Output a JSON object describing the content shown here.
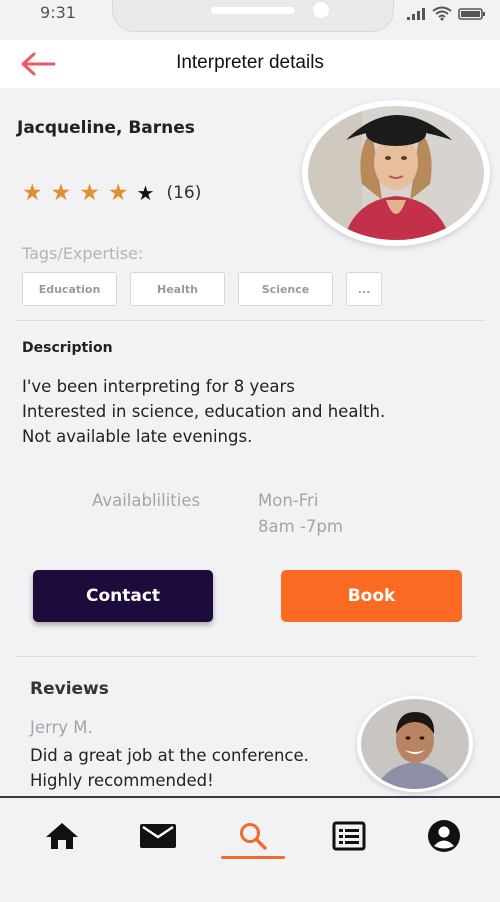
{
  "status_bar": {
    "time": "9:31"
  },
  "header": {
    "title": "Interpreter details",
    "back_icon": "arrow-left-icon",
    "accent": "#f05a5a"
  },
  "profile": {
    "name": "Jacqueline, Barnes",
    "rating": {
      "stars_filled": 4,
      "stars_total": 5,
      "count": "(16)"
    },
    "tags_label": "Tags/Expertise:",
    "tags": [
      "Education",
      "Health",
      "Science",
      "..."
    ]
  },
  "description": {
    "title": "Description",
    "lines": [
      "I've been interpreting for 8 years",
      "Interested in science, education and health.",
      "Not available late evenings."
    ]
  },
  "availability": {
    "label": "Availablilities",
    "days": "Mon-Fri",
    "hours": "8am -7pm"
  },
  "actions": {
    "contact_label": "Contact",
    "book_label": "Book",
    "contact_color": "#1c0b3b",
    "book_color": "#fb6a23"
  },
  "reviews": {
    "title": "Reviews",
    "items": [
      {
        "author": "Jerry M.",
        "lines": [
          "Did a great job at the conference.",
          "Highly recommended!"
        ]
      }
    ]
  },
  "tab_bar": {
    "items": [
      "home-icon",
      "mail-icon",
      "search-icon",
      "list-icon",
      "account-icon"
    ],
    "active": "search-icon",
    "active_color": "#f26a2e"
  }
}
